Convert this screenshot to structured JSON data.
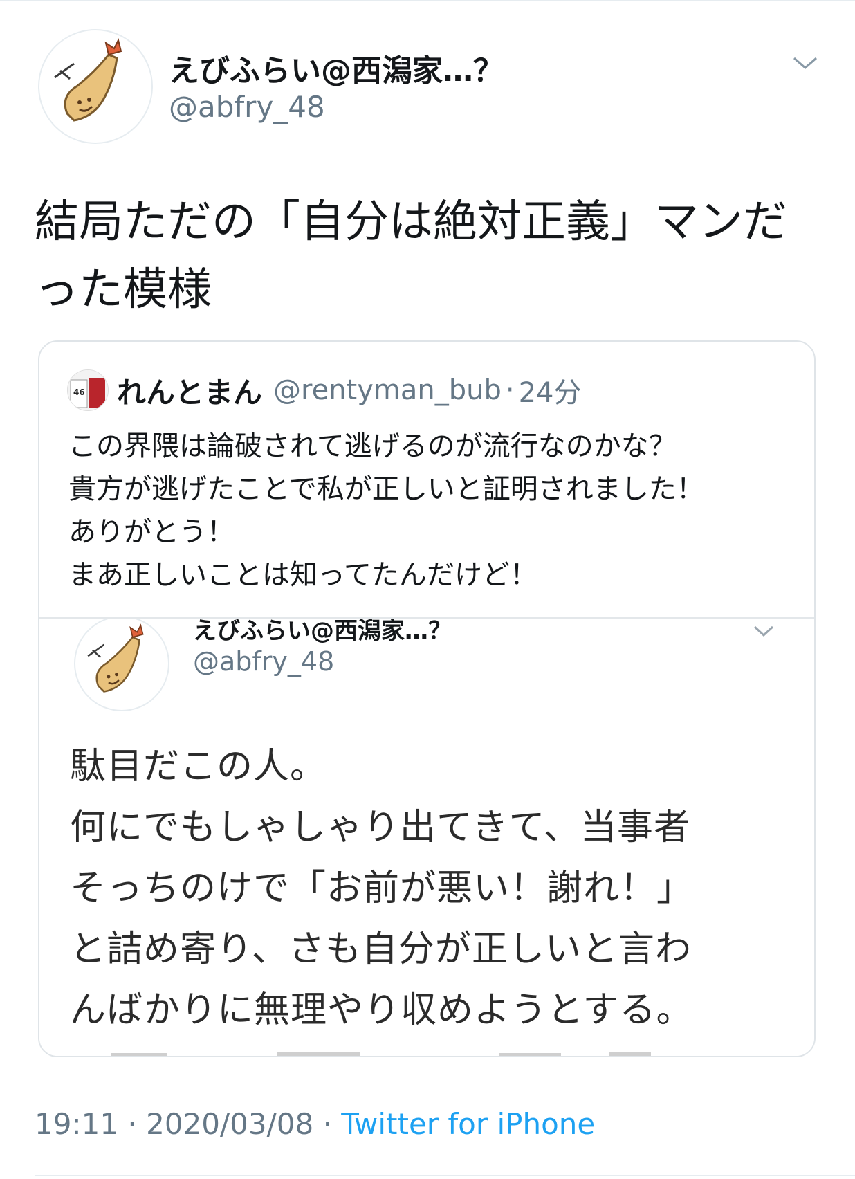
{
  "tweet": {
    "display_name": "えびふらい@西潟家…？",
    "handle": "@abfry_48",
    "text": "結局ただの「自分は絶対正義」マンだ\nった模様",
    "time": "19:11",
    "date": "2020/03/08",
    "separator": "·",
    "source": "Twitter for iPhone"
  },
  "quote": {
    "display_name": "れんとまん",
    "handle": "@rentyman_bub",
    "separator": "·",
    "time": "24分",
    "text": "この界隈は論破されて逃げるのが流行なのかな？\n貴方が逃げたことで私が正しいと証明されました！\nありがとう！\nまあ正しいことは知ってたんだけど！",
    "image": {
      "display_name": "えびふらい@西潟家…？",
      "handle": "@abfry_48",
      "text": "駄目だこの人。\n何にでもしゃしゃり出てきて、当事者\nそっちのけで「お前が悪い！謝れ！」\nと詰め寄り、さも自分が正しいと言わ\nんばかりに無理やり収めようとする。"
    }
  },
  "icons": {
    "avatar": "fried-shrimp-avatar-icon",
    "caret": "chevron-down-icon",
    "quote_avatar": "baseball-jersey-avatar-icon"
  },
  "colors": {
    "link": "#1da1f2",
    "muted": "#657786",
    "text": "#14171a",
    "border": "#e6ecf0"
  }
}
